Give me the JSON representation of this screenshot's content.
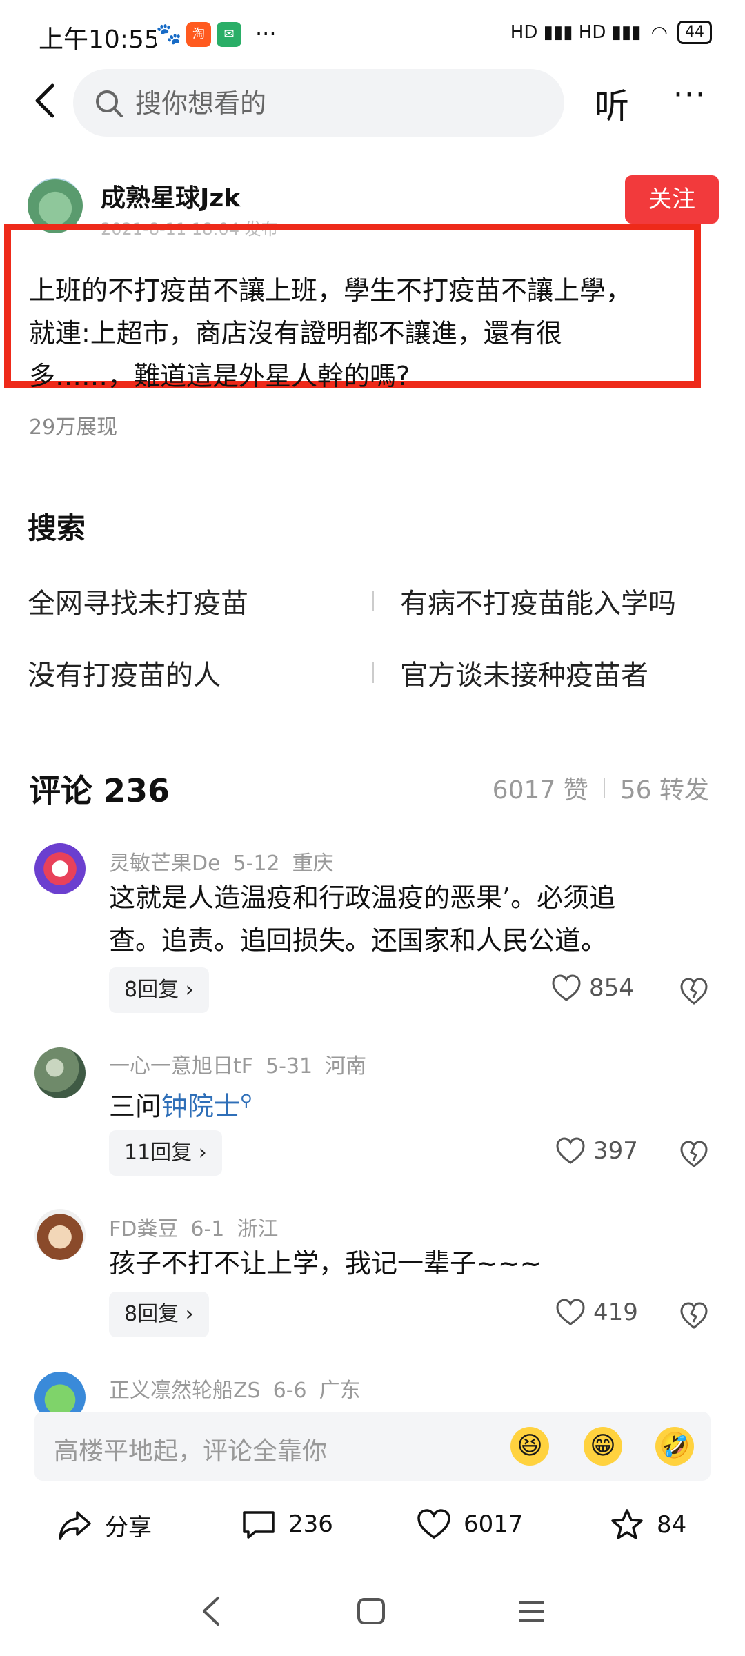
{
  "status": {
    "time": "上午10:55",
    "right": "HD ▮▮▮ HD ▮▮▮",
    "battery": "44"
  },
  "topbar": {
    "search_placeholder": "搜你想看的",
    "listen": "听",
    "more": "···"
  },
  "post": {
    "author": "成熟星球Jzk",
    "follow": "关注",
    "date_faint": "2021-8-11 18:04 发布",
    "text_line1": "上班的不打疫苗不讓上班，學生不打疫苗不讓上學，",
    "text_line2": "就連:上超市，商店沒有證明都不讓進，還有很",
    "text_line3": "多……，難道這是外星人幹的嗎?",
    "views": "29万展现"
  },
  "search_section": {
    "title": "搜索",
    "items": [
      "全网寻找未打疫苗",
      "有病不打疫苗能入学吗",
      "没有打疫苗的人",
      "官方谈未接种疫苗者"
    ]
  },
  "comments_header": {
    "title": "评论 236",
    "likes": "6017 赞",
    "shares": "56 转发"
  },
  "comments": [
    {
      "user": "灵敏芒果De",
      "date": "5-12",
      "region": "重庆",
      "line1": "这就是人造温疫和行政温疫的恶果’。必须追",
      "line2": "查。追责。追回损失。还国家和人民公道。",
      "replies": "8回复 ›",
      "likes": "854"
    },
    {
      "user": "一心一意旭日tF",
      "date": "5-31",
      "region": "河南",
      "line1_prefix": "三问",
      "line1_link": "钟院士",
      "replies": "11回复 ›",
      "likes": "397"
    },
    {
      "user": "FD粪豆",
      "date": "6-1",
      "region": "浙江",
      "line1": "孩子不打不让上学，我记一辈子~~~",
      "replies": "8回复 ›",
      "likes": "419"
    },
    {
      "user": "正义凛然轮船ZS",
      "date": "6-6",
      "region": "广东"
    }
  ],
  "input": {
    "placeholder": "高楼平地起，评论全靠你"
  },
  "actions": {
    "share": "分享",
    "comments": "236",
    "likes": "6017",
    "favorites": "84"
  }
}
